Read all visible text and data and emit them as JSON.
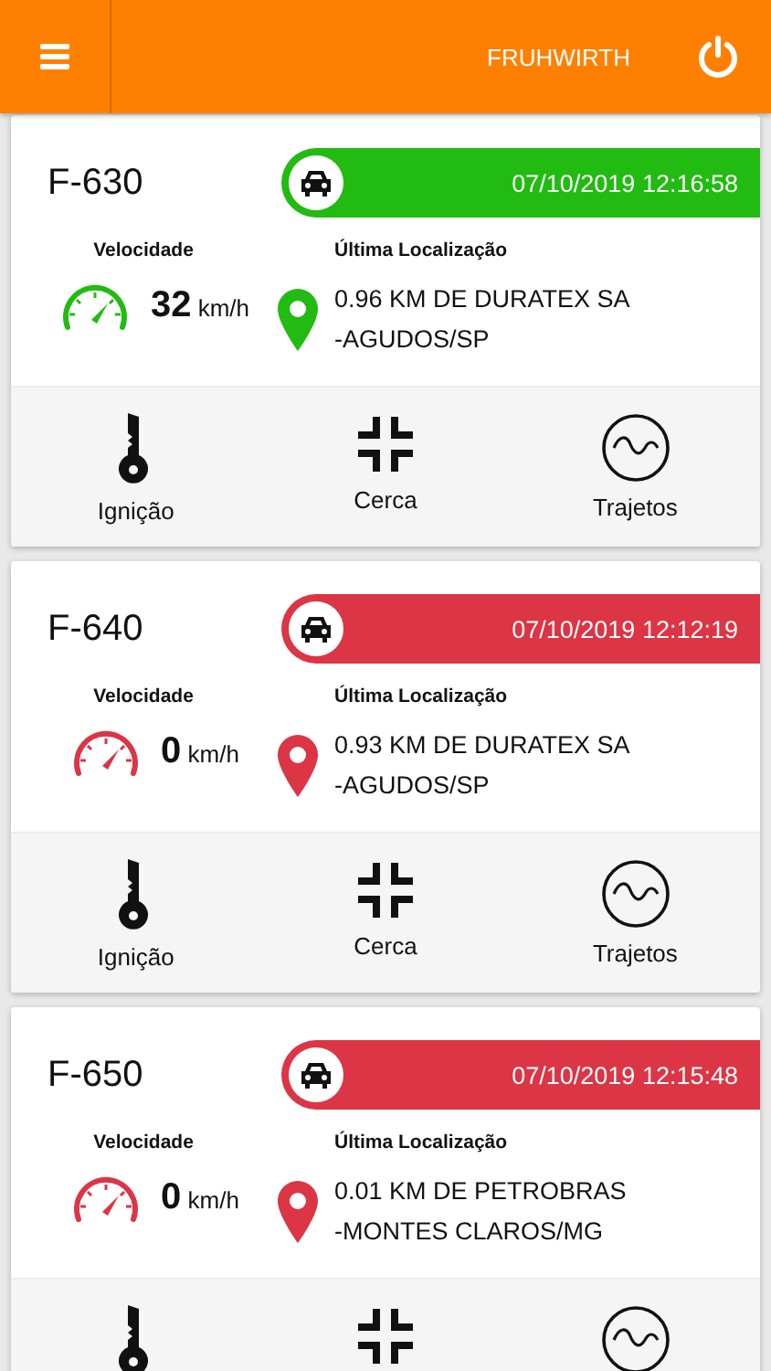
{
  "header": {
    "user": "FRUHWIRTH"
  },
  "vehicles": [
    {
      "plate": "F-630",
      "color": "#22bb11",
      "timestamp": "07/10/2019 12:16:58",
      "speed_label": "Velocidade",
      "speed": "32",
      "unit": "km/h",
      "location_label": "Última Localização",
      "location": [
        "0.96 KM DE DURATEX SA",
        "-AGUDOS/SP"
      ],
      "actions": [
        {
          "kind": "key",
          "label": "Ignição"
        },
        {
          "kind": "fence",
          "label": "Cerca"
        },
        {
          "kind": "route",
          "label": "Trajetos"
        }
      ]
    },
    {
      "plate": "F-640",
      "color": "#dc3545",
      "timestamp": "07/10/2019 12:12:19",
      "speed_label": "Velocidade",
      "speed": "0",
      "unit": "km/h",
      "location_label": "Última Localização",
      "location": [
        "0.93 KM DE DURATEX SA",
        "-AGUDOS/SP"
      ],
      "actions": [
        {
          "kind": "key",
          "label": "Ignição"
        },
        {
          "kind": "fence",
          "label": "Cerca"
        },
        {
          "kind": "route",
          "label": "Trajetos"
        }
      ]
    },
    {
      "plate": "F-650",
      "color": "#dc3545",
      "timestamp": "07/10/2019 12:15:48",
      "speed_label": "Velocidade",
      "speed": "0",
      "unit": "km/h",
      "location_label": "Última Localização",
      "location": [
        "0.01 KM DE PETROBRAS",
        "-MONTES CLAROS/MG"
      ],
      "actions": [
        {
          "kind": "key"
        },
        {
          "kind": "fence"
        },
        {
          "kind": "route"
        }
      ]
    }
  ]
}
